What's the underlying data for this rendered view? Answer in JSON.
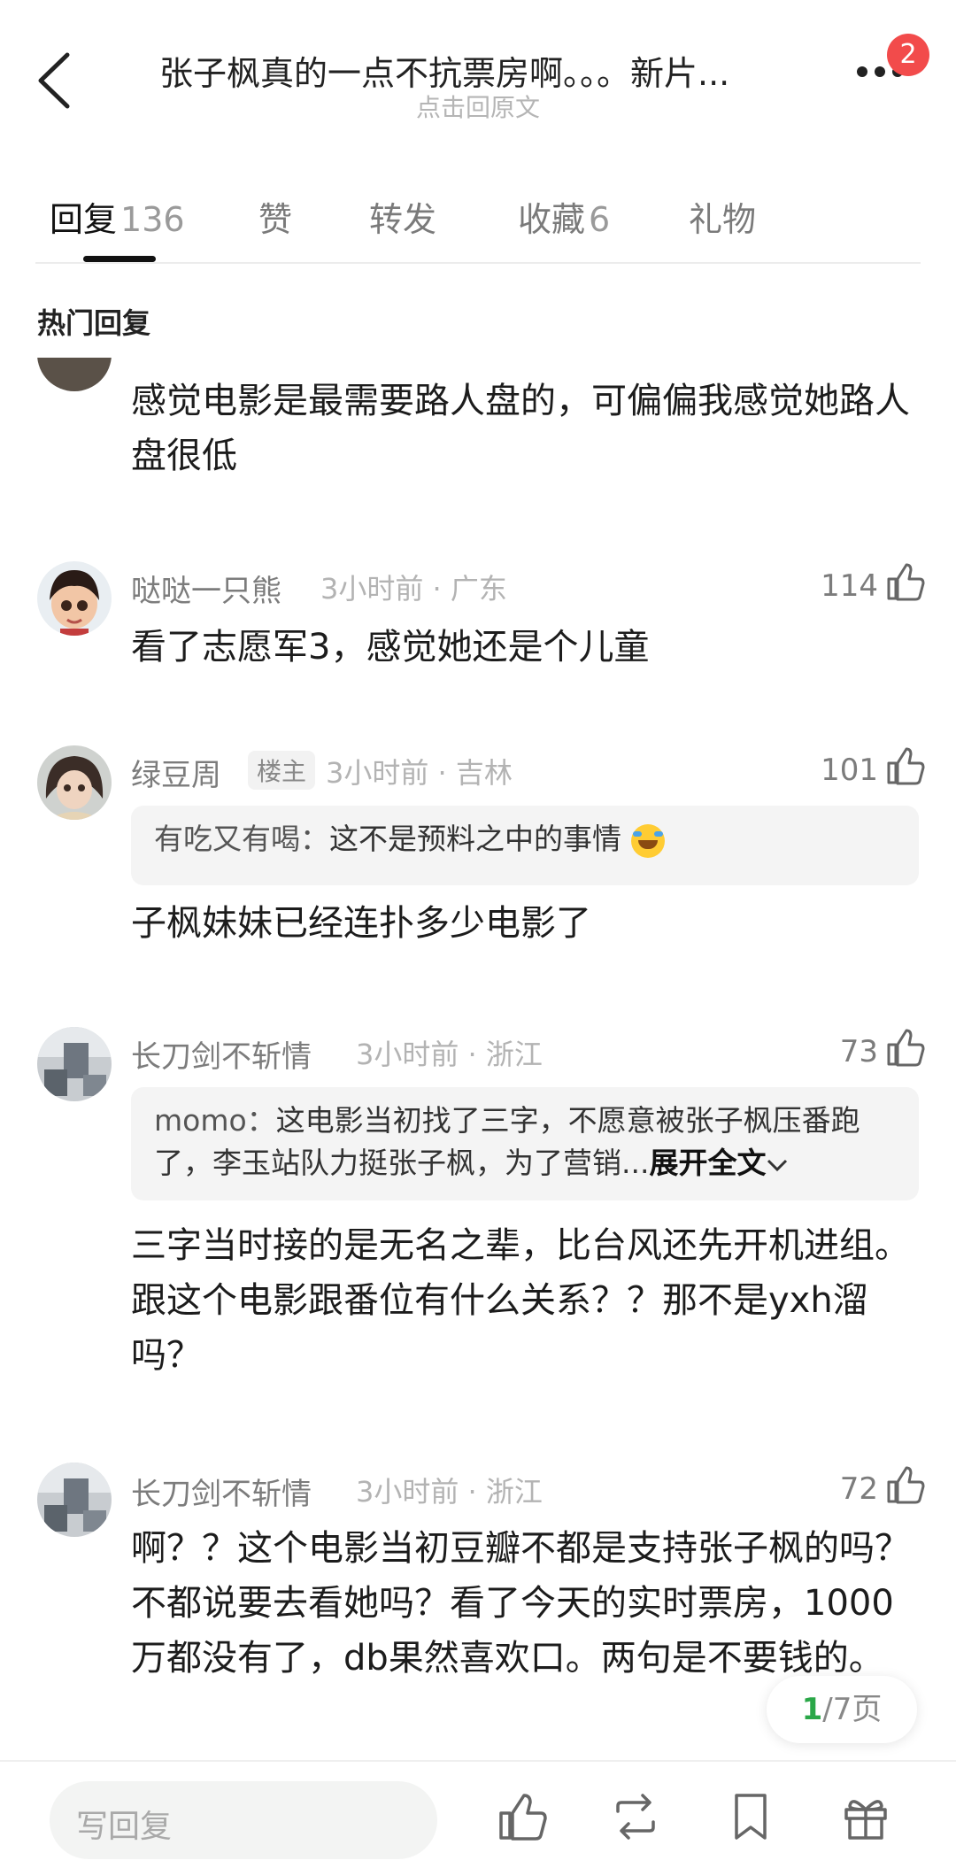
{
  "header": {
    "title": "张子枫真的一点不抗票房啊。。。新片...",
    "subtitle": "点击回原文",
    "badge_count": "2"
  },
  "tabs": [
    {
      "label": "回复",
      "count": "136"
    },
    {
      "label": "赞",
      "count": ""
    },
    {
      "label": "转发",
      "count": ""
    },
    {
      "label": "收藏",
      "count": "6"
    },
    {
      "label": "礼物",
      "count": ""
    }
  ],
  "section_title": "热门回复",
  "comments": [
    {
      "text": "感觉电影是最需要路人盘的，可偏偏我感觉她路人盘很低"
    },
    {
      "name": "哒哒一只熊",
      "time": "3小时前",
      "location": "广东",
      "likes": "114",
      "text": "看了志愿军3，感觉她还是个儿童"
    },
    {
      "name": "绿豆周",
      "op_label": "楼主",
      "time": "3小时前",
      "location": "吉林",
      "likes": "101",
      "quote_author": "有吃又有喝：",
      "quote_text": "这不是预料之中的事情",
      "text": "子枫妹妹已经连扑多少电影了"
    },
    {
      "name": "长刀剑不斩情",
      "time": "3小时前",
      "location": "浙江",
      "likes": "73",
      "quote_author": "momo：",
      "quote_text": "这电影当初找了三字，不愿意被张子枫压番跑了，李玉站队力挺张子枫，为了营销...",
      "quote_expand": "展开全文",
      "text": "三字当时接的是无名之辈，比台风还先开机进组。跟这个电影跟番位有什么关系？？那不是yxh溜吗？"
    },
    {
      "name": "长刀剑不斩情",
      "time": "3小时前",
      "location": "浙江",
      "likes": "72",
      "text": "啊？？这个电影当初豆瓣不都是支持张子枫的吗？不都说要去看她吗？看了今天的实时票房，1000万都没有了，db果然喜欢口。两句是不要钱的。"
    }
  ],
  "pager": {
    "current": "1",
    "total_text": "/7页"
  },
  "bottom_bar": {
    "reply_placeholder": "写回复"
  },
  "colors": {
    "accent_green": "#2aa748",
    "badge_red": "#f24b4b"
  }
}
